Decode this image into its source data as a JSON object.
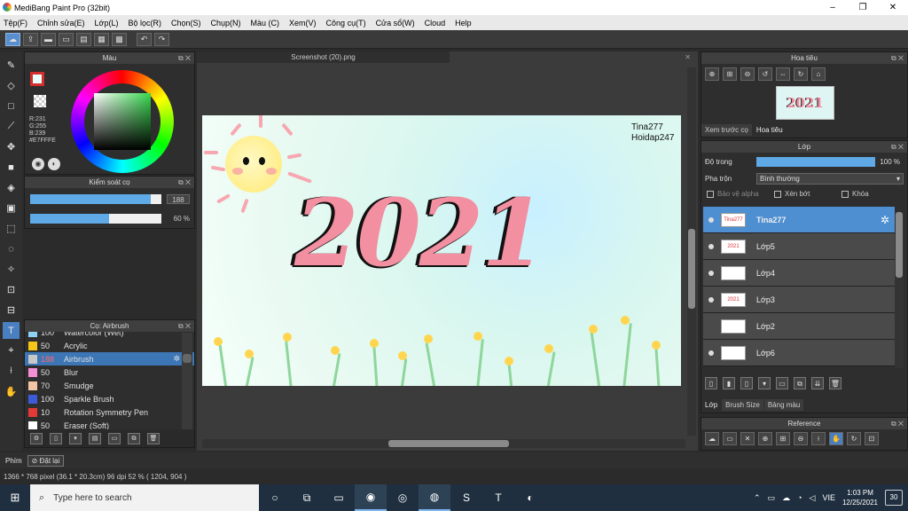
{
  "window": {
    "title": "MediBang Paint Pro (32bit)",
    "controls": [
      "–",
      "❐",
      "✕"
    ]
  },
  "menu": [
    "Tệp(F)",
    "Chỉnh sửa(E)",
    "Lớp(L)",
    "Bộ lọc(R)",
    "Chọn(S)",
    "Chụp(N)",
    "Màu (C)",
    "Xem(V)",
    "Công cụ(T)",
    "Cửa sổ(W)",
    "Cloud",
    "Help"
  ],
  "color_panel": {
    "title": "Màu",
    "rgb": [
      "R:231",
      "G:255",
      "B:239",
      "#E7FFFE"
    ],
    "fg_color": "#E7FFFE",
    "border_color": "#D32F2F"
  },
  "brush_control": {
    "title": "Kiểm soát cọ",
    "size": "188",
    "size_fraction": 0.92,
    "opacity": "60 %",
    "opacity_fraction": 0.6
  },
  "brush_list": {
    "title": "Cọ: Airbrush",
    "items": [
      {
        "size": "100",
        "name": "Watercolor (Wet)",
        "color": "#8fd3f4"
      },
      {
        "size": "50",
        "name": "Acrylic",
        "color": "#f5c518"
      },
      {
        "size": "188",
        "name": "Airbrush",
        "color": "#c8c8c8",
        "selected": true
      },
      {
        "size": "50",
        "name": "Blur",
        "color": "#f48fd6"
      },
      {
        "size": "70",
        "name": "Smudge",
        "color": "#f5c6a5"
      },
      {
        "size": "100",
        "name": "Sparkle Brush",
        "color": "#3b5bd9"
      },
      {
        "size": "10",
        "name": "Rotation Symmetry Pen",
        "color": "#e53935"
      },
      {
        "size": "50",
        "name": "Eraser (Soft)",
        "color": "#ffffff"
      }
    ]
  },
  "document": {
    "tab_title": "Screenshot (20).png",
    "artwork_text": "2021",
    "signature_line1": "Tina277",
    "signature_line2": "Hoidap247"
  },
  "navigator": {
    "title": "Hoa tiêu",
    "tabs": [
      "Xem trước cọ",
      "Hoa tiêu"
    ],
    "thumb_text": "2021"
  },
  "layers": {
    "title": "Lớp",
    "opacity_label": "Độ trong",
    "opacity_value": "100 %",
    "blend_label": "Pha trộn",
    "blend_value": "Bình thường",
    "checks": {
      "protect_alpha": "Bảo vệ alpha",
      "clip": "Xén bớt",
      "lock": "Khóa"
    },
    "items": [
      {
        "name": "Tina277",
        "thumb": "Tina277 Hoidap247",
        "selected": true,
        "visible": true
      },
      {
        "name": "Lớp5",
        "thumb": "2021",
        "visible": true
      },
      {
        "name": "Lớp4",
        "thumb": "",
        "visible": true
      },
      {
        "name": "Lớp3",
        "thumb": "2021",
        "visible": true
      },
      {
        "name": "Lớp2",
        "thumb": "",
        "visible": false
      },
      {
        "name": "Lớp6",
        "thumb": "",
        "visible": true
      }
    ],
    "tabs": [
      "Lớp",
      "Brush Size",
      "Bảng màu"
    ]
  },
  "reference": {
    "title": "Reference"
  },
  "hint": {
    "label": "Phím",
    "undo": "Đặt lại"
  },
  "status": "1366 * 768 pixel   (36.1 * 20.3cm)   96 dpi   52 %   ( 1204, 904 )",
  "taskbar": {
    "search_placeholder": "Type here to search",
    "lang": "VIE",
    "time": "1:03 PM",
    "date": "12/25/2021",
    "notifications": "30"
  }
}
